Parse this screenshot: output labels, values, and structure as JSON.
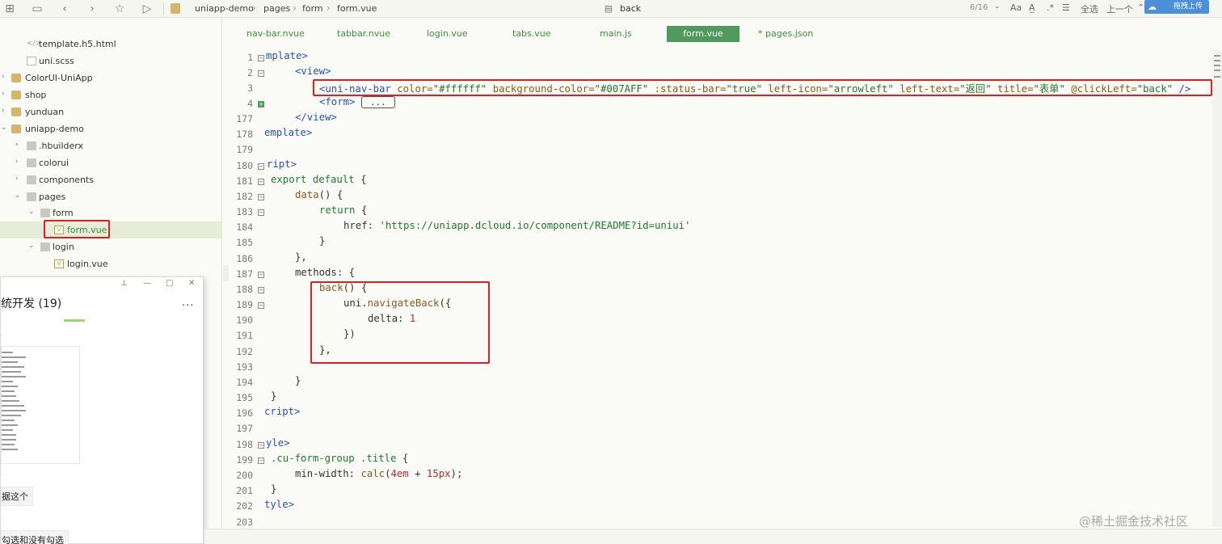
{
  "toolbar": {
    "breadcrumb": [
      "uniapp-demo",
      "pages",
      "form",
      "form.vue"
    ],
    "find_value": "back",
    "find_count": "6/16",
    "btn_case": "Aa",
    "btn_word": "A̲",
    "btn_regex": ".*",
    "btn_select_all": "全选",
    "btn_prev": "上一个",
    "upload_label": "拖拽上传"
  },
  "sidebar": {
    "items": [
      {
        "label": "template.h5.html"
      },
      {
        "label": "uni.scss"
      },
      {
        "label": "ColorUI-UniApp"
      },
      {
        "label": "shop"
      },
      {
        "label": "yunduan"
      },
      {
        "label": "uniapp-demo"
      },
      {
        "label": ".hbuilderx"
      },
      {
        "label": "colorui"
      },
      {
        "label": "components"
      },
      {
        "label": "pages"
      },
      {
        "label": "form"
      },
      {
        "label": "form.vue"
      },
      {
        "label": "login"
      },
      {
        "label": "login.vue"
      }
    ]
  },
  "popup": {
    "title": "统开发 (19)",
    "more": "...",
    "msg1": "据这个",
    "msg2": "勾选和没有勾选"
  },
  "tabs": [
    "nav-bar.nvue",
    "tabbar.nvue",
    "login.vue",
    "tabs.vue",
    "main.js",
    "form.vue",
    "* pages.json"
  ],
  "editor": {
    "line_numbers": [
      "1",
      "2",
      "3",
      "4",
      "177",
      "178",
      "179",
      "180",
      "181",
      "182",
      "183",
      "184",
      "185",
      "186",
      "187",
      "188",
      "189",
      "190",
      "191",
      "192",
      "193",
      "194",
      "195",
      "196",
      "197",
      "198",
      "199",
      "200",
      "201",
      "202",
      "203"
    ],
    "code": {
      "l1": "mplate>",
      "l2_tag": "<view>",
      "l3_open": "<uni-nav-bar",
      "l3_a1": "color=",
      "l3_v1": "\"#ffffff\"",
      "l3_a2": "background-color=",
      "l3_v2": "\"#007AFF\"",
      "l3_a3": ":status-bar=",
      "l3_v3": "\"true\"",
      "l3_a4": "left-icon=",
      "l3_v4": "\"arrowleft\"",
      "l3_a5": "left-text=",
      "l3_v5": "\"返回\"",
      "l3_a6": "title=",
      "l3_v6": "\"表单\"",
      "l3_a7": "@clickLeft=",
      "l3_v7": "\"back\"",
      "l3_close": "/>",
      "l4_tag": "<form>",
      "l4_fold": "...",
      "l177": "</view>",
      "l178": "emplate>",
      "l180": "ript>",
      "l181_kw": "export default",
      "l181_p": "{",
      "l182_fn": "data",
      "l182_p": "() {",
      "l183_kw": "return",
      "l183_p": "{",
      "l184_k": "href",
      "l184_v": "'https://uniapp.dcloud.io/component/README?id=uniui'",
      "l185": "}",
      "l186": "},",
      "l187_k": "methods",
      "l187_p": ": {",
      "l188_fn": "back",
      "l188_p": "() {",
      "l189_a": "uni",
      "l189_fn": "navigateBack",
      "l189_p": "({",
      "l190_k": "delta",
      "l190_n": "1",
      "l191": "})",
      "l192": "},",
      "l194": "}",
      "l195": "}",
      "l196": "cript>",
      "l198": "yle>",
      "l199_sel": ".cu-form-group .title",
      "l199_p": "{",
      "l200_k": "min-width",
      "l200_fn": "calc",
      "l200_n1": "4em",
      "l200_n2": "15px",
      "l201": "}",
      "l202": "tyle>"
    }
  },
  "watermark": "@稀土掘金技术社区",
  "colors": {
    "accent": "#4f9a5c",
    "highlight": "#e02020",
    "tag": "#2552b2"
  }
}
